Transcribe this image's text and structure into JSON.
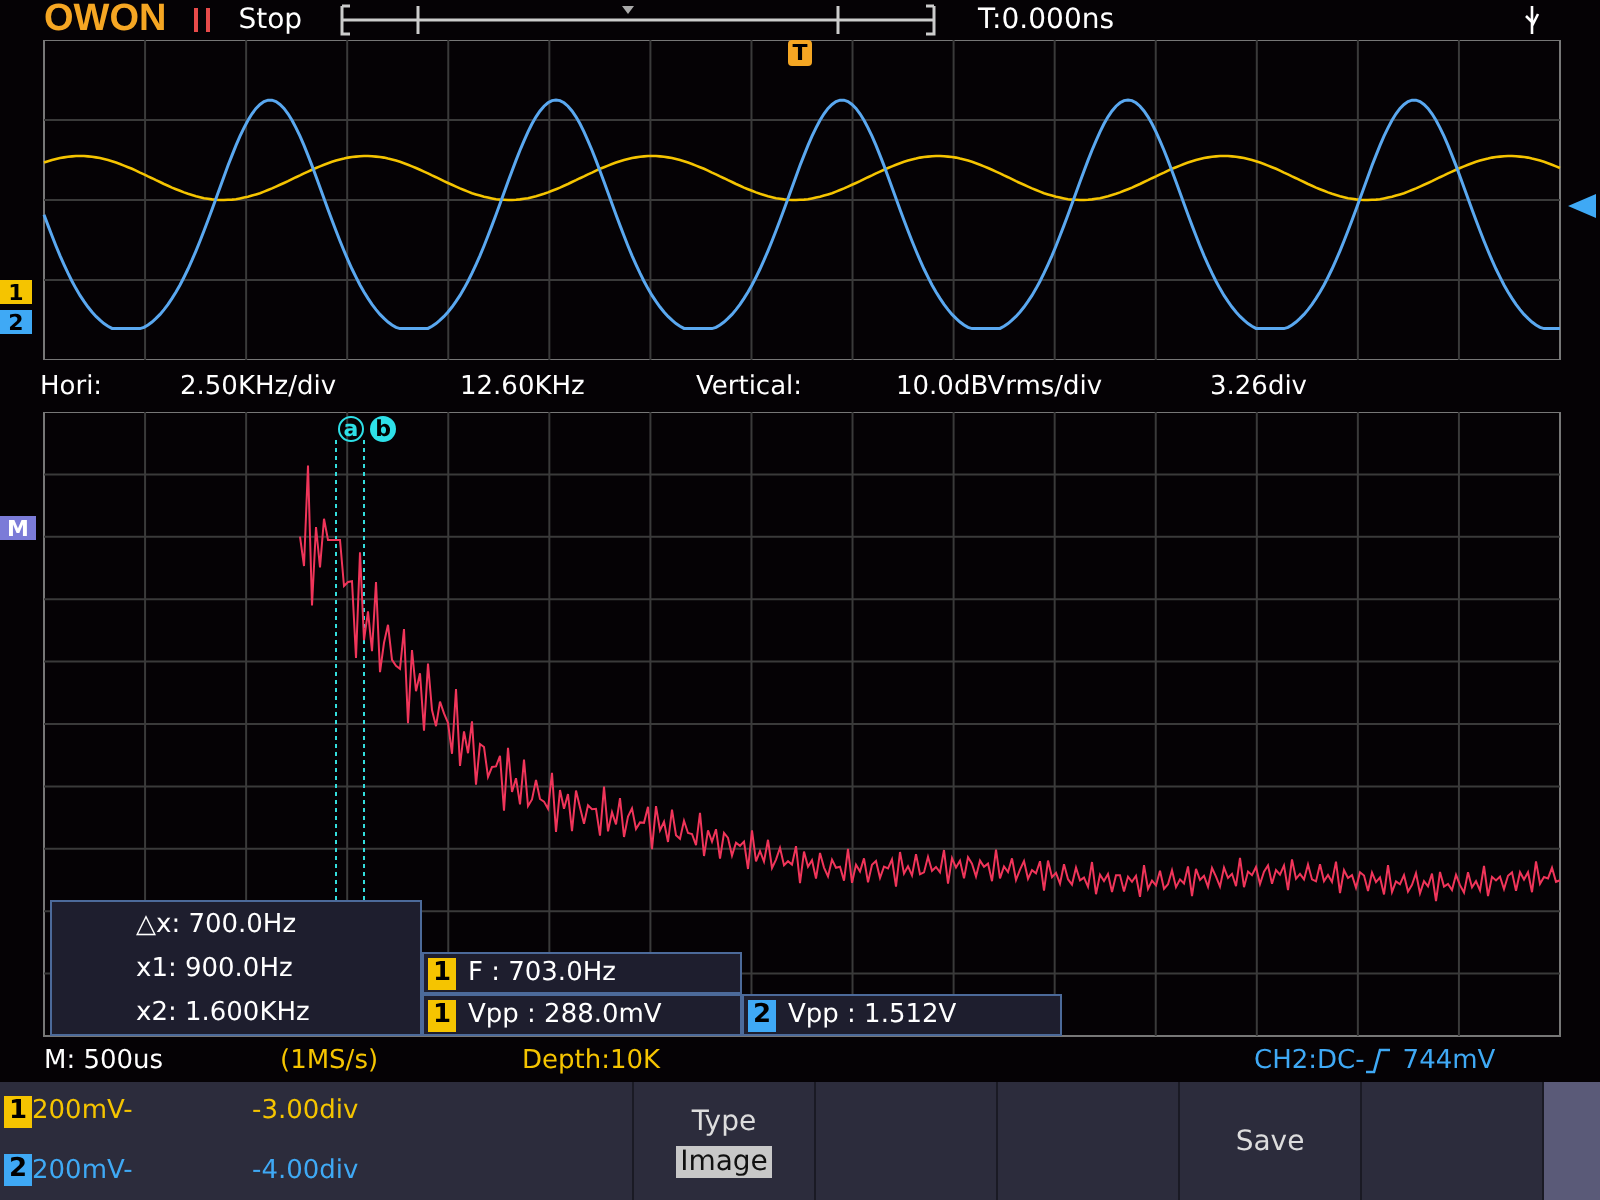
{
  "header": {
    "logo": "OWON",
    "run_state": "Stop",
    "trigger_time": "T:0.000ns"
  },
  "upper_screen": {
    "trigger_marker": "T",
    "channel_markers": [
      {
        "label": "1",
        "color": "#f5c400"
      },
      {
        "label": "2",
        "color": "#3fa9f5"
      }
    ]
  },
  "fft_info": {
    "hori_label": "Hori:",
    "hori_scale": "2.50KHz/div",
    "hori_center": "12.60KHz",
    "vert_label": "Vertical:",
    "vert_scale": "10.0dBVrms/div",
    "vert_offset": "3.26div"
  },
  "fft_screen": {
    "math_marker": "M",
    "cursor_labels": [
      "a",
      "b"
    ],
    "cursor_readout": [
      "△x: 700.0Hz",
      "x1: 900.0Hz",
      "x2: 1.600KHz"
    ],
    "measurements": [
      {
        "channel": "1",
        "color": "#f5c400",
        "text": "F : 703.0Hz"
      },
      {
        "channel": "1",
        "color": "#f5c400",
        "text": "Vpp : 288.0mV"
      },
      {
        "channel": "2",
        "color": "#3fa9f5",
        "text": "Vpp : 1.512V"
      }
    ]
  },
  "status": {
    "timebase": "M: 500us",
    "sample_rate": "(1MS/s)",
    "depth": "Depth:10K",
    "trigger": "CH2:DC-",
    "trigger_level": "744mV"
  },
  "channels": [
    {
      "number": "1",
      "color": "#f5c400",
      "scale": "200mV-",
      "offset": "-3.00div"
    },
    {
      "number": "2",
      "color": "#3fa9f5",
      "scale": "200mV-",
      "offset": "-4.00div"
    }
  ],
  "menu": [
    {
      "kind": "option",
      "title": "Type",
      "value": "Image"
    },
    {
      "kind": "empty"
    },
    {
      "kind": "empty"
    },
    {
      "kind": "action",
      "title": "Save"
    },
    {
      "kind": "empty"
    }
  ]
}
